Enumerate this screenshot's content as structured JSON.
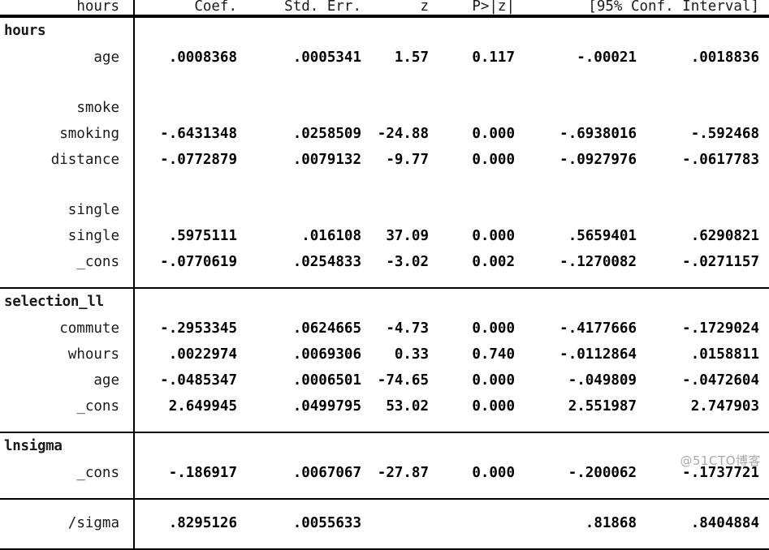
{
  "table": {
    "columns": {
      "label": "hours",
      "coef": "Coef.",
      "std_err": "Std. Err.",
      "z": "z",
      "p": "P>|z|",
      "ci": "[95% Conf. Interval]"
    },
    "groups": [
      {
        "name": "hours",
        "rows": [
          {
            "label": "age",
            "coef": ".0008368",
            "std_err": ".0005341",
            "z": "1.57",
            "p": "0.117",
            "ci_low": "-.00021",
            "ci_high": ".0018836"
          },
          {
            "label": "",
            "coef": "",
            "std_err": "",
            "z": "",
            "p": "",
            "ci_low": "",
            "ci_high": ""
          },
          {
            "label": "smoke",
            "coef": "",
            "std_err": "",
            "z": "",
            "p": "",
            "ci_low": "",
            "ci_high": ""
          },
          {
            "label": "smoking",
            "coef": "-.6431348",
            "std_err": ".0258509",
            "z": "-24.88",
            "p": "0.000",
            "ci_low": "-.6938016",
            "ci_high": "-.592468"
          },
          {
            "label": "distance",
            "coef": "-.0772879",
            "std_err": ".0079132",
            "z": "-9.77",
            "p": "0.000",
            "ci_low": "-.0927976",
            "ci_high": "-.0617783"
          },
          {
            "label": "",
            "coef": "",
            "std_err": "",
            "z": "",
            "p": "",
            "ci_low": "",
            "ci_high": ""
          },
          {
            "label": "single",
            "coef": "",
            "std_err": "",
            "z": "",
            "p": "",
            "ci_low": "",
            "ci_high": ""
          },
          {
            "label": "single",
            "coef": ".5975111",
            "std_err": ".016108",
            "z": "37.09",
            "p": "0.000",
            "ci_low": ".5659401",
            "ci_high": ".6290821"
          },
          {
            "label": "_cons",
            "coef": "-.0770619",
            "std_err": ".0254833",
            "z": "-3.02",
            "p": "0.002",
            "ci_low": "-.1270082",
            "ci_high": "-.0271157"
          }
        ]
      },
      {
        "name": "selection_ll",
        "rows": [
          {
            "label": "commute",
            "coef": "-.2953345",
            "std_err": ".0624665",
            "z": "-4.73",
            "p": "0.000",
            "ci_low": "-.4177666",
            "ci_high": "-.1729024"
          },
          {
            "label": "whours",
            "coef": ".0022974",
            "std_err": ".0069306",
            "z": "0.33",
            "p": "0.740",
            "ci_low": "-.0112864",
            "ci_high": ".0158811"
          },
          {
            "label": "age",
            "coef": "-.0485347",
            "std_err": ".0006501",
            "z": "-74.65",
            "p": "0.000",
            "ci_low": "-.049809",
            "ci_high": "-.0472604"
          },
          {
            "label": "_cons",
            "coef": "2.649945",
            "std_err": ".0499795",
            "z": "53.02",
            "p": "0.000",
            "ci_low": "2.551987",
            "ci_high": "2.747903"
          }
        ]
      },
      {
        "name": "lnsigma",
        "rows": [
          {
            "label": "_cons",
            "coef": "-.186917",
            "std_err": ".0067067",
            "z": "-27.87",
            "p": "0.000",
            "ci_low": "-.200062",
            "ci_high": "-.1737721"
          }
        ]
      }
    ],
    "footer_rows": [
      {
        "label": "/sigma",
        "coef": ".8295126",
        "std_err": ".0055633",
        "z": "",
        "p": "",
        "ci_low": ".81868",
        "ci_high": ".8404884"
      }
    ]
  },
  "watermark": {
    "text": "@51CTO博客"
  }
}
